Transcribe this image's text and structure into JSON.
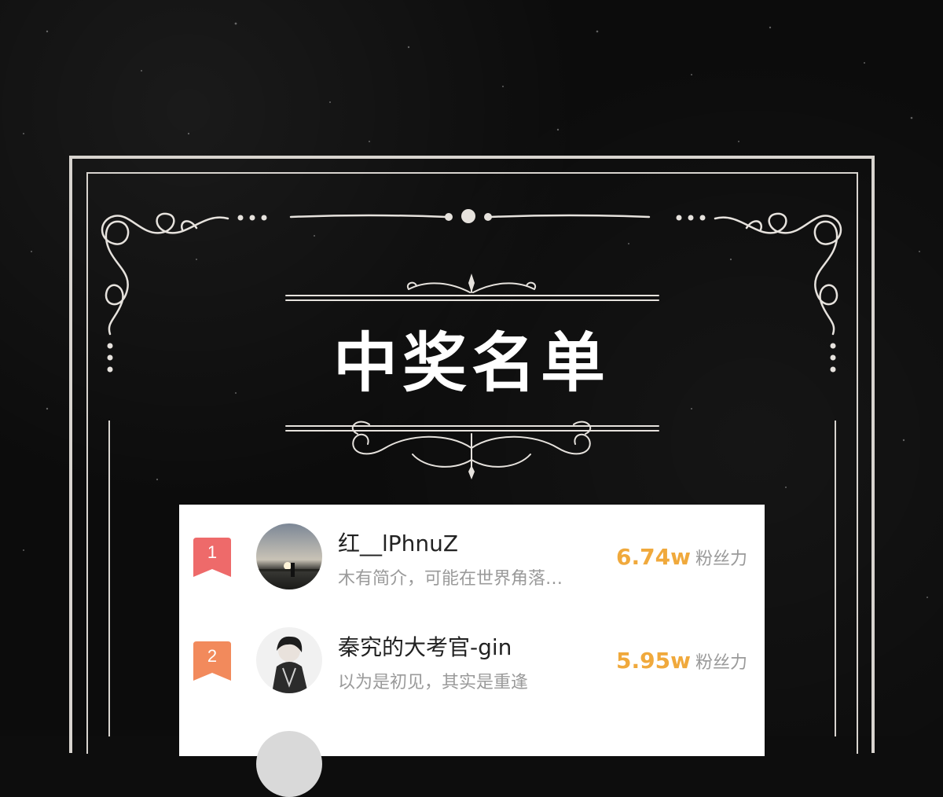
{
  "title": "中奖名单",
  "colors": {
    "background": "#0c0c0c",
    "frame": "#d8d4cf",
    "card": "#ffffff",
    "fans_value": "#f0a93c",
    "badge_1": "#ee6a6a",
    "badge_2": "#f28a5c"
  },
  "winners": [
    {
      "rank": "1",
      "name": "红__lPhnuZ",
      "bio": "木有简介，可能在世界角落…",
      "fans_value": "6.74w",
      "fans_label": "粉丝力",
      "avatar": "sunset-photo-avatar"
    },
    {
      "rank": "2",
      "name": "秦究的大考官-gin",
      "bio": "以为是初见，其实是重逢",
      "fans_value": "5.95w",
      "fans_label": "粉丝力",
      "avatar": "anime-character-avatar"
    }
  ]
}
